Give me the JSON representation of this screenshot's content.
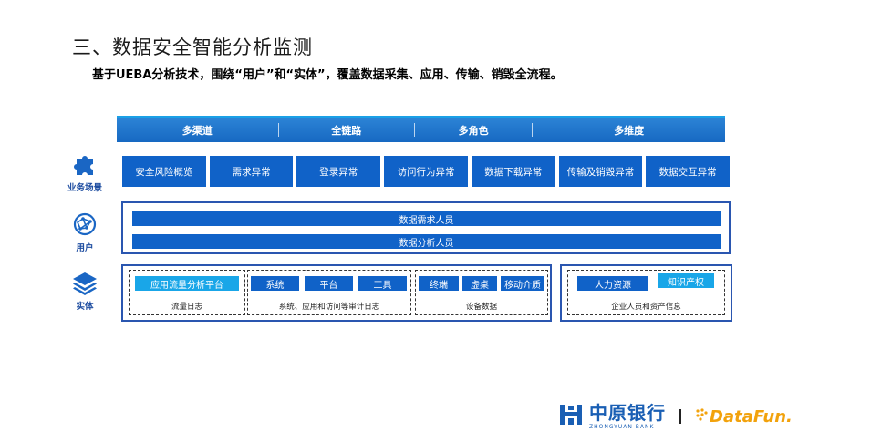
{
  "title": "三、数据安全智能分析监测",
  "subtitle": "基于UEBA分析技术，围绕“用户”和“实体”，覆盖数据采集、应用、传输、销毁全流程。",
  "header": [
    "多渠道",
    "全链路",
    "多角色",
    "多维度"
  ],
  "sides": {
    "scenario": {
      "label": "业务场景",
      "icon": "puzzle-icon"
    },
    "user": {
      "label": "用户",
      "icon": "network-globe-icon"
    },
    "entity": {
      "label": "实体",
      "icon": "layers-icon"
    }
  },
  "scenarios": [
    "安全风险概览",
    "需求异常",
    "登录异常",
    "访问行为异常",
    "数据下载异常",
    "传输及销毁异常",
    "数据交互异常"
  ],
  "users": [
    "数据需求人员",
    "数据分析人员"
  ],
  "entities": {
    "g1": {
      "chips": [
        "应用流量分析平台"
      ],
      "label": "流量日志"
    },
    "g2": {
      "chips": [
        "系统",
        "平台",
        "工具"
      ],
      "label": "系统、应用和访问等审计日志"
    },
    "g3": {
      "chips": [
        "终端",
        "虚桌",
        "移动介质"
      ],
      "label": "设备数据"
    },
    "g4": {
      "chips": [
        "人力资源",
        "知识产权"
      ],
      "label": "企业人员和资产信息"
    }
  },
  "footer": {
    "bank_cn": "中原银行",
    "bank_en": "ZHONGYUAN BANK",
    "partner": "DataFun."
  },
  "colors": {
    "primary": "#1062c8",
    "accent": "#19a6e8",
    "border": "#2a56b0",
    "partner": "#f2a20c"
  }
}
